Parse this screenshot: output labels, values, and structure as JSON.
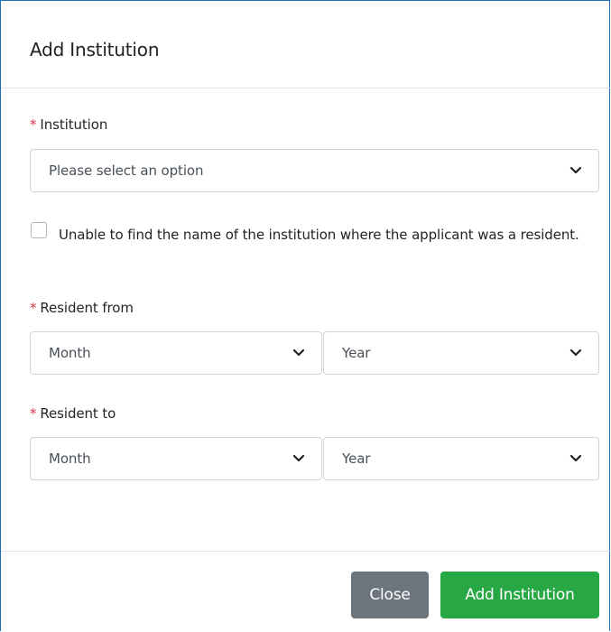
{
  "modal": {
    "title": "Add Institution"
  },
  "institution": {
    "required_marker": "*",
    "label": "Institution",
    "selected": "Please select an option"
  },
  "not_found": {
    "checked": false,
    "label": "Unable to find the name of the institution where the applicant was a resident."
  },
  "resident_from": {
    "required_marker": "*",
    "label": "Resident from",
    "month": "Month",
    "year": "Year"
  },
  "resident_to": {
    "required_marker": "*",
    "label": "Resident to",
    "month": "Month",
    "year": "Year"
  },
  "footer": {
    "close_label": "Close",
    "add_label": "Add Institution"
  },
  "colors": {
    "required": "#dc3545",
    "close_button": "#6c757d",
    "add_button": "#28a745",
    "modal_border": "#1f6fb8"
  },
  "icons": {
    "select_arrow": "chevron-down-icon"
  }
}
